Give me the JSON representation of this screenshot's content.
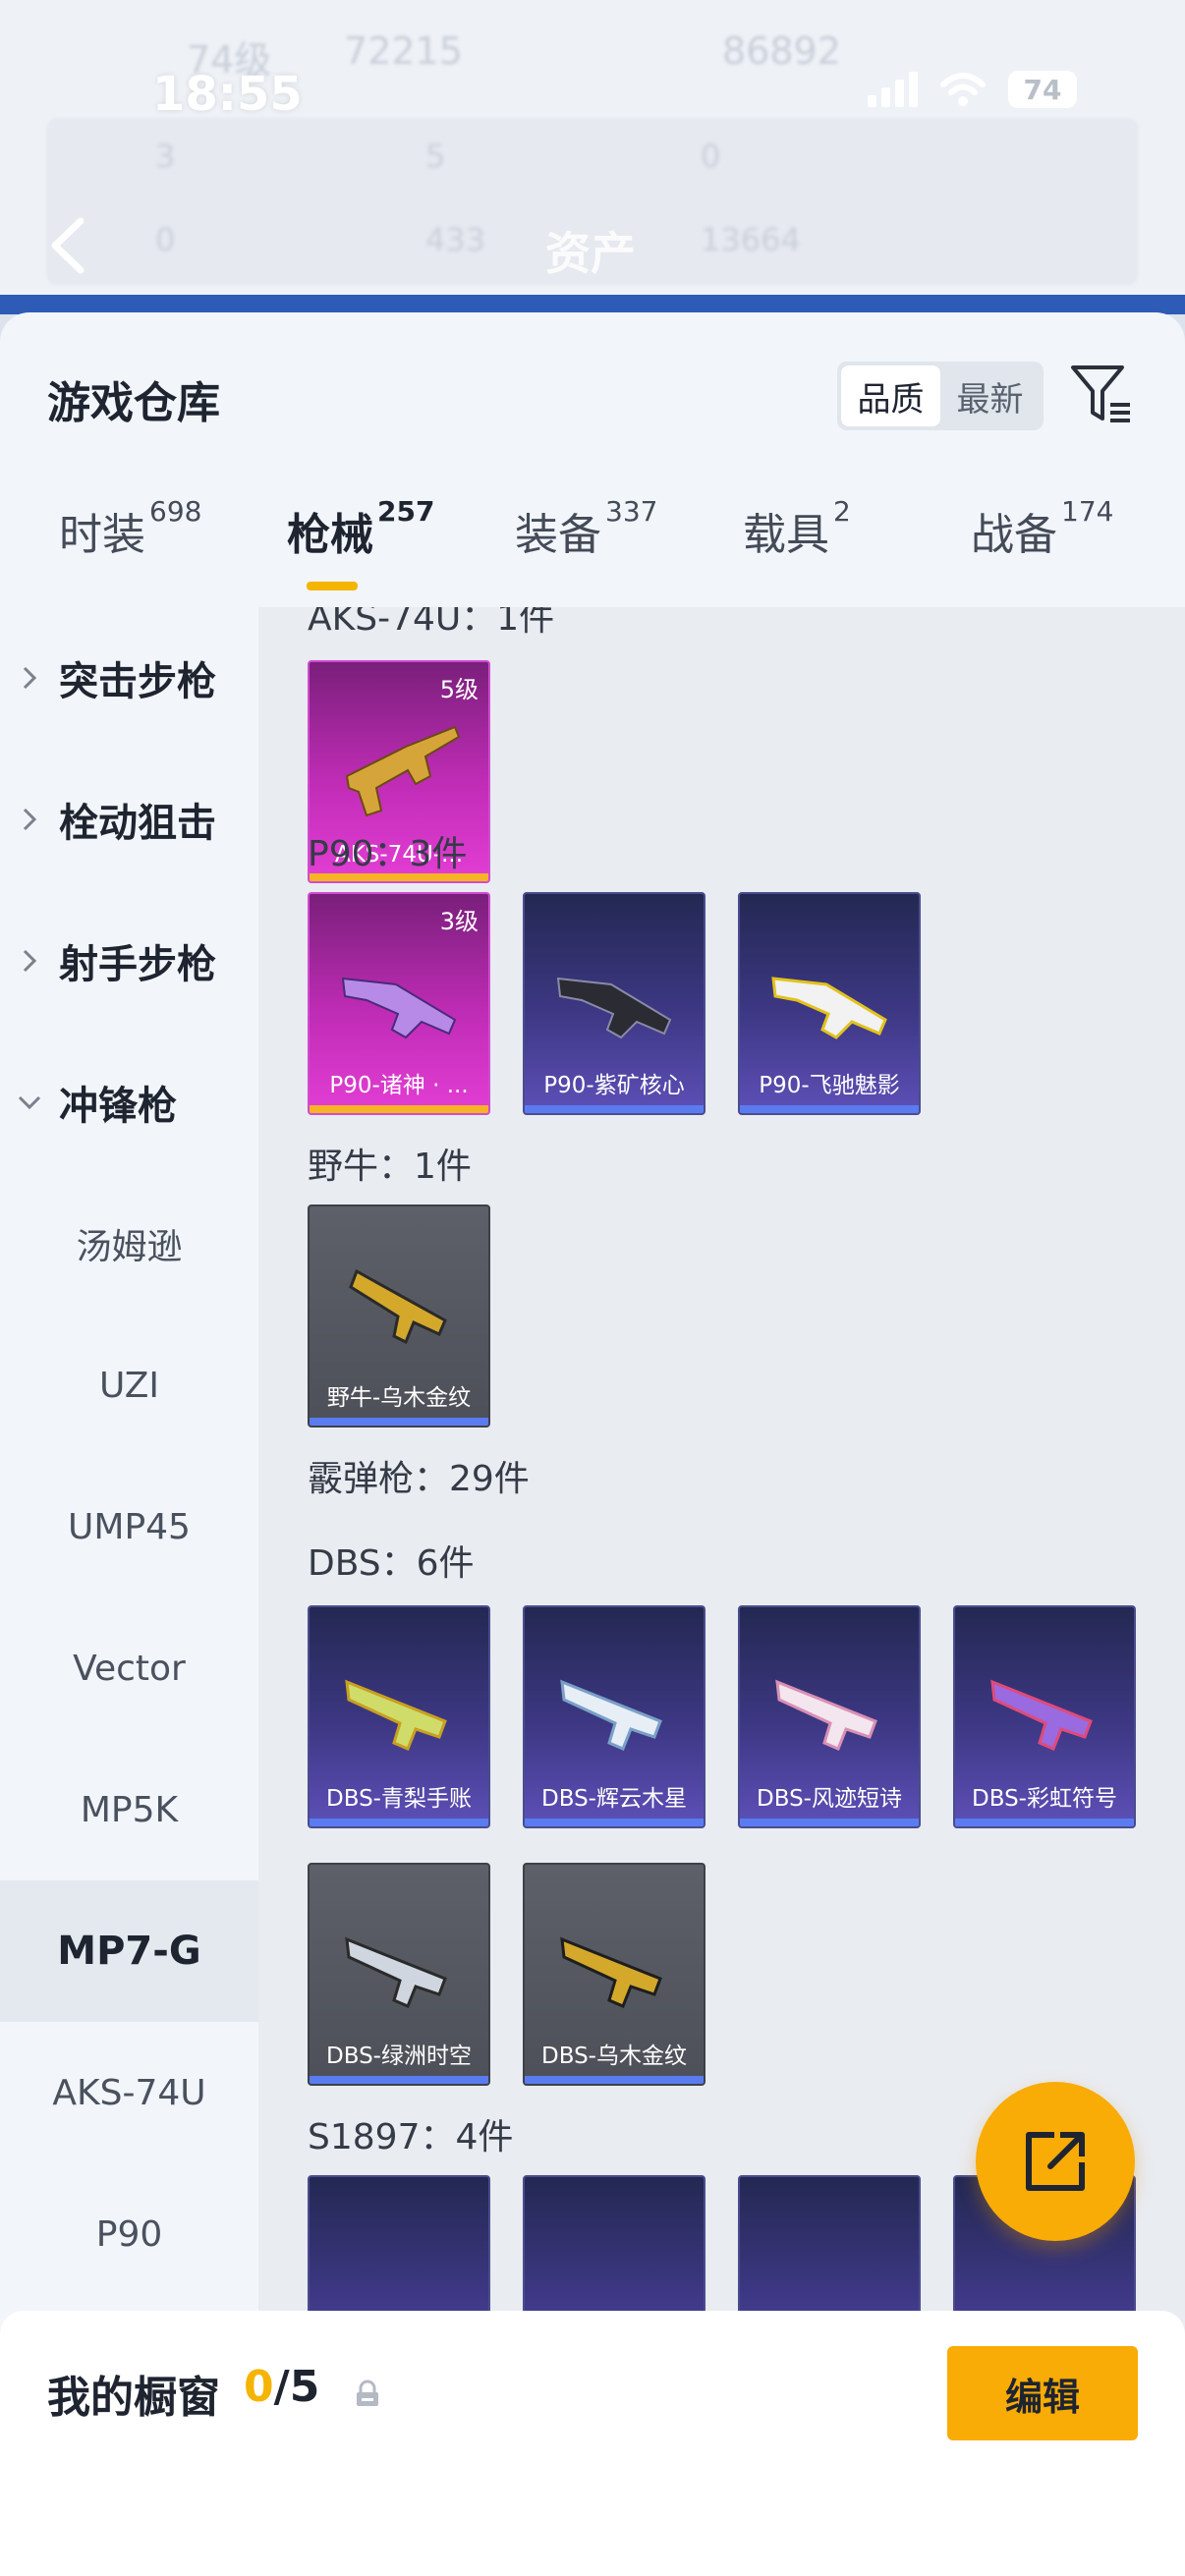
{
  "status": {
    "time": "18:55",
    "battery": "74"
  },
  "header": {
    "title": "资产"
  },
  "ghost_bg": {
    "level": "74级",
    "coins": "72215",
    "gold": "86892",
    "stat1": "3",
    "stat2": "5",
    "stat3": "0",
    "stat4": "0",
    "stat5": "433",
    "stat6": "13664"
  },
  "sheet": {
    "title": "游戏仓库",
    "sort": {
      "options": [
        "品质",
        "最新"
      ],
      "selected": "品质"
    }
  },
  "tabs": [
    {
      "label": "时装",
      "count": "698"
    },
    {
      "label": "枪械",
      "count": "257"
    },
    {
      "label": "装备",
      "count": "337"
    },
    {
      "label": "载具",
      "count": "2"
    },
    {
      "label": "战备",
      "count": "174"
    }
  ],
  "sidebar": {
    "categories": [
      "突击步枪",
      "栓动狙击",
      "射手步枪",
      "冲锋枪"
    ],
    "subs": [
      "汤姆逊",
      "UZI",
      "UMP45",
      "Vector",
      "MP5K",
      "MP7-G",
      "AKS-74U",
      "P90"
    ],
    "active_sub": "MP7-G"
  },
  "content": {
    "groups": [
      {
        "title": "AKS-74U：1件",
        "items": [
          {
            "name": "AKS-74U-...",
            "level": "5级",
            "rarity": "pink"
          }
        ]
      },
      {
        "title": "P90：3件",
        "items": [
          {
            "name": "P90-诸神 · ...",
            "level": "3级",
            "rarity": "pink"
          },
          {
            "name": "P90-紫矿核心",
            "rarity": "purple"
          },
          {
            "name": "P90-飞驰魅影",
            "rarity": "purple"
          }
        ]
      },
      {
        "title": "野牛：1件",
        "items": [
          {
            "name": "野牛-乌木金纹",
            "rarity": "gray"
          }
        ]
      },
      {
        "title": "霰弹枪：29件"
      },
      {
        "title": "DBS：6件",
        "items": [
          {
            "name": "DBS-青梨手账",
            "rarity": "purple"
          },
          {
            "name": "DBS-辉云木星",
            "rarity": "purple"
          },
          {
            "name": "DBS-风迹短诗",
            "rarity": "purple"
          },
          {
            "name": "DBS-彩虹符号",
            "rarity": "purple"
          },
          {
            "name": "DBS-绿洲时空",
            "rarity": "gray"
          },
          {
            "name": "DBS-乌木金纹",
            "rarity": "gray"
          }
        ]
      },
      {
        "title": "S1897：4件"
      }
    ]
  },
  "showcase": {
    "label": "我的橱窗",
    "count_current": "0",
    "count_sep": "/5",
    "edit_label": "编辑"
  },
  "colors": {
    "accent": "#f9ab06",
    "pink_rarity": "#c02cb6",
    "purple_rarity": "#3e3885",
    "gray_rarity": "#4d5058"
  }
}
